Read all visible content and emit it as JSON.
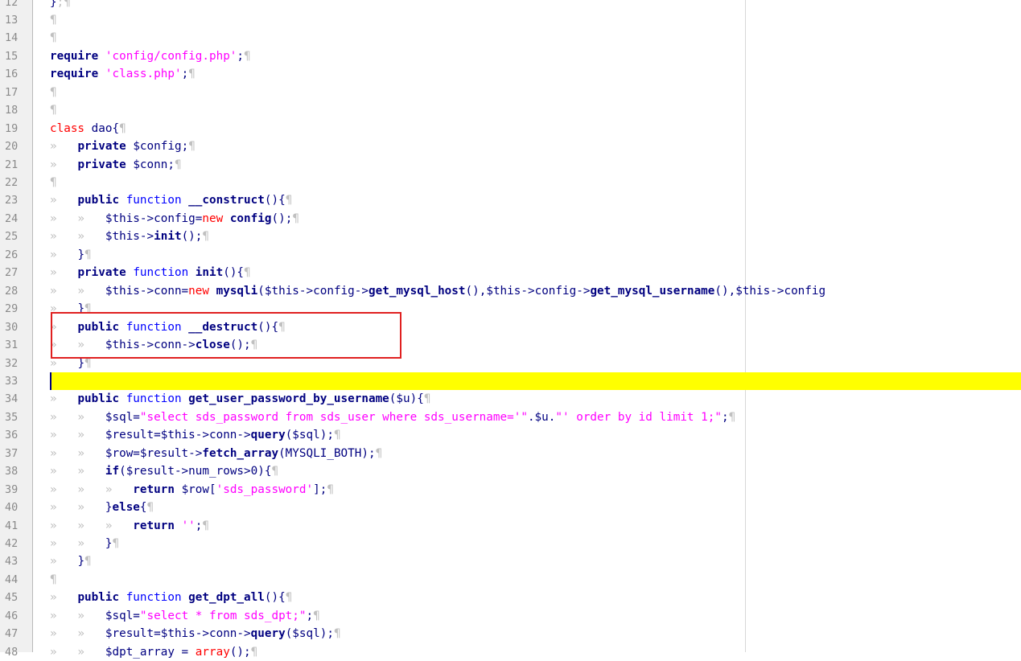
{
  "editor": {
    "line_numbers": [
      "12",
      "13",
      "14",
      "15",
      "16",
      "17",
      "18",
      "19",
      "20",
      "21",
      "22",
      "23",
      "24",
      "25",
      "26",
      "27",
      "28",
      "29",
      "30",
      "31",
      "32",
      "33",
      "34",
      "35",
      "36",
      "37",
      "38",
      "39",
      "40",
      "41",
      "42",
      "43",
      "44",
      "45",
      "46",
      "47",
      "48"
    ],
    "highlighted_line": "33",
    "annotated_lines": [
      "30",
      "31"
    ]
  },
  "code": [
    [
      {
        "t": "}",
        "c": "var"
      },
      {
        "t": ";¶",
        "c": "ws"
      }
    ],
    [
      {
        "t": "¶",
        "c": "ws"
      }
    ],
    [
      {
        "t": "¶",
        "c": "ws"
      }
    ],
    [
      {
        "t": "require ",
        "c": "kw"
      },
      {
        "t": "'config/config.php'",
        "c": "str"
      },
      {
        "t": ";",
        "c": "var"
      },
      {
        "t": "¶",
        "c": "ws"
      }
    ],
    [
      {
        "t": "require ",
        "c": "kw"
      },
      {
        "t": "'class.php'",
        "c": "str"
      },
      {
        "t": ";",
        "c": "var"
      },
      {
        "t": "¶",
        "c": "ws"
      }
    ],
    [
      {
        "t": "¶",
        "c": "ws"
      }
    ],
    [
      {
        "t": "¶",
        "c": "ws"
      }
    ],
    [
      {
        "t": "class",
        "c": "kw3"
      },
      {
        "t": " dao{",
        "c": "var"
      },
      {
        "t": "¶",
        "c": "ws"
      }
    ],
    [
      {
        "t": "»   ",
        "c": "ws"
      },
      {
        "t": "private ",
        "c": "kw"
      },
      {
        "t": "$config;",
        "c": "var"
      },
      {
        "t": "¶",
        "c": "ws"
      }
    ],
    [
      {
        "t": "»   ",
        "c": "ws"
      },
      {
        "t": "private ",
        "c": "kw"
      },
      {
        "t": "$conn;",
        "c": "var"
      },
      {
        "t": "¶",
        "c": "ws"
      }
    ],
    [
      {
        "t": "¶",
        "c": "ws"
      }
    ],
    [
      {
        "t": "»   ",
        "c": "ws"
      },
      {
        "t": "public ",
        "c": "kw"
      },
      {
        "t": "function ",
        "c": "kw2"
      },
      {
        "t": "__construct",
        "c": "kw"
      },
      {
        "t": "(){",
        "c": "var"
      },
      {
        "t": "¶",
        "c": "ws"
      }
    ],
    [
      {
        "t": "»   »   ",
        "c": "ws"
      },
      {
        "t": "$this->config=",
        "c": "var"
      },
      {
        "t": "new",
        "c": "kw3"
      },
      {
        "t": " config",
        "c": "kw"
      },
      {
        "t": "();",
        "c": "var"
      },
      {
        "t": "¶",
        "c": "ws"
      }
    ],
    [
      {
        "t": "»   »   ",
        "c": "ws"
      },
      {
        "t": "$this->",
        "c": "var"
      },
      {
        "t": "init",
        "c": "kw"
      },
      {
        "t": "();",
        "c": "var"
      },
      {
        "t": "¶",
        "c": "ws"
      }
    ],
    [
      {
        "t": "»   ",
        "c": "ws"
      },
      {
        "t": "}",
        "c": "var"
      },
      {
        "t": "¶",
        "c": "ws"
      }
    ],
    [
      {
        "t": "»   ",
        "c": "ws"
      },
      {
        "t": "private ",
        "c": "kw"
      },
      {
        "t": "function ",
        "c": "kw2"
      },
      {
        "t": "init",
        "c": "kw"
      },
      {
        "t": "(){",
        "c": "var"
      },
      {
        "t": "¶",
        "c": "ws"
      }
    ],
    [
      {
        "t": "»   »   ",
        "c": "ws"
      },
      {
        "t": "$this->conn=",
        "c": "var"
      },
      {
        "t": "new",
        "c": "kw3"
      },
      {
        "t": " mysqli",
        "c": "kw"
      },
      {
        "t": "($this->config->",
        "c": "var"
      },
      {
        "t": "get_mysql_host",
        "c": "kw"
      },
      {
        "t": "(),$this->config->",
        "c": "var"
      },
      {
        "t": "get_mysql_username",
        "c": "kw"
      },
      {
        "t": "(),$this->config",
        "c": "var"
      }
    ],
    [
      {
        "t": "»   ",
        "c": "ws"
      },
      {
        "t": "}",
        "c": "var"
      },
      {
        "t": "¶",
        "c": "ws"
      }
    ],
    [
      {
        "t": "»   ",
        "c": "ws"
      },
      {
        "t": "public ",
        "c": "kw"
      },
      {
        "t": "function ",
        "c": "kw2"
      },
      {
        "t": "__destruct",
        "c": "kw"
      },
      {
        "t": "(){",
        "c": "var"
      },
      {
        "t": "¶",
        "c": "ws"
      }
    ],
    [
      {
        "t": "»   »   ",
        "c": "ws"
      },
      {
        "t": "$this->conn->",
        "c": "var"
      },
      {
        "t": "close",
        "c": "kw"
      },
      {
        "t": "();",
        "c": "var"
      },
      {
        "t": "¶",
        "c": "ws"
      }
    ],
    [
      {
        "t": "»   ",
        "c": "ws"
      },
      {
        "t": "}",
        "c": "var"
      },
      {
        "t": "¶",
        "c": "ws"
      }
    ],
    [],
    [
      {
        "t": "»   ",
        "c": "ws"
      },
      {
        "t": "public ",
        "c": "kw"
      },
      {
        "t": "function ",
        "c": "kw2"
      },
      {
        "t": "get_user_password_by_username",
        "c": "kw"
      },
      {
        "t": "($u){",
        "c": "var"
      },
      {
        "t": "¶",
        "c": "ws"
      }
    ],
    [
      {
        "t": "»   »   ",
        "c": "ws"
      },
      {
        "t": "$sql=",
        "c": "var"
      },
      {
        "t": "\"select sds_password from sds_user where sds_username='\"",
        "c": "str"
      },
      {
        "t": ".$u.",
        "c": "var"
      },
      {
        "t": "\"' order by id limit 1;\"",
        "c": "str"
      },
      {
        "t": ";",
        "c": "var"
      },
      {
        "t": "¶",
        "c": "ws"
      }
    ],
    [
      {
        "t": "»   »   ",
        "c": "ws"
      },
      {
        "t": "$result=$this->conn->",
        "c": "var"
      },
      {
        "t": "query",
        "c": "kw"
      },
      {
        "t": "($sql);",
        "c": "var"
      },
      {
        "t": "¶",
        "c": "ws"
      }
    ],
    [
      {
        "t": "»   »   ",
        "c": "ws"
      },
      {
        "t": "$row=$result->",
        "c": "var"
      },
      {
        "t": "fetch_array",
        "c": "kw"
      },
      {
        "t": "(MYSQLI_BOTH);",
        "c": "var"
      },
      {
        "t": "¶",
        "c": "ws"
      }
    ],
    [
      {
        "t": "»   »   ",
        "c": "ws"
      },
      {
        "t": "if",
        "c": "kw"
      },
      {
        "t": "($result->num_rows>0){",
        "c": "var"
      },
      {
        "t": "¶",
        "c": "ws"
      }
    ],
    [
      {
        "t": "»   »   »   ",
        "c": "ws"
      },
      {
        "t": "return ",
        "c": "kw"
      },
      {
        "t": "$row[",
        "c": "var"
      },
      {
        "t": "'sds_password'",
        "c": "str"
      },
      {
        "t": "];",
        "c": "var"
      },
      {
        "t": "¶",
        "c": "ws"
      }
    ],
    [
      {
        "t": "»   »   ",
        "c": "ws"
      },
      {
        "t": "}",
        "c": "var"
      },
      {
        "t": "else",
        "c": "kw"
      },
      {
        "t": "{",
        "c": "var"
      },
      {
        "t": "¶",
        "c": "ws"
      }
    ],
    [
      {
        "t": "»   »   »   ",
        "c": "ws"
      },
      {
        "t": "return ",
        "c": "kw"
      },
      {
        "t": "''",
        "c": "str"
      },
      {
        "t": ";",
        "c": "var"
      },
      {
        "t": "¶",
        "c": "ws"
      }
    ],
    [
      {
        "t": "»   »   ",
        "c": "ws"
      },
      {
        "t": "}",
        "c": "var"
      },
      {
        "t": "¶",
        "c": "ws"
      }
    ],
    [
      {
        "t": "»   ",
        "c": "ws"
      },
      {
        "t": "}",
        "c": "var"
      },
      {
        "t": "¶",
        "c": "ws"
      }
    ],
    [
      {
        "t": "¶",
        "c": "ws"
      }
    ],
    [
      {
        "t": "»   ",
        "c": "ws"
      },
      {
        "t": "public ",
        "c": "kw"
      },
      {
        "t": "function ",
        "c": "kw2"
      },
      {
        "t": "get_dpt_all",
        "c": "kw"
      },
      {
        "t": "(){",
        "c": "var"
      },
      {
        "t": "¶",
        "c": "ws"
      }
    ],
    [
      {
        "t": "»   »   ",
        "c": "ws"
      },
      {
        "t": "$sql=",
        "c": "var"
      },
      {
        "t": "\"select * from sds_dpt;\"",
        "c": "str"
      },
      {
        "t": ";",
        "c": "var"
      },
      {
        "t": "¶",
        "c": "ws"
      }
    ],
    [
      {
        "t": "»   »   ",
        "c": "ws"
      },
      {
        "t": "$result=$this->conn->",
        "c": "var"
      },
      {
        "t": "query",
        "c": "kw"
      },
      {
        "t": "($sql);",
        "c": "var"
      },
      {
        "t": "¶",
        "c": "ws"
      }
    ],
    [
      {
        "t": "»   »   ",
        "c": "ws"
      },
      {
        "t": "$dpt_array = ",
        "c": "var"
      },
      {
        "t": "array",
        "c": "kw3"
      },
      {
        "t": "();",
        "c": "var"
      },
      {
        "t": "¶",
        "c": "ws"
      }
    ]
  ]
}
